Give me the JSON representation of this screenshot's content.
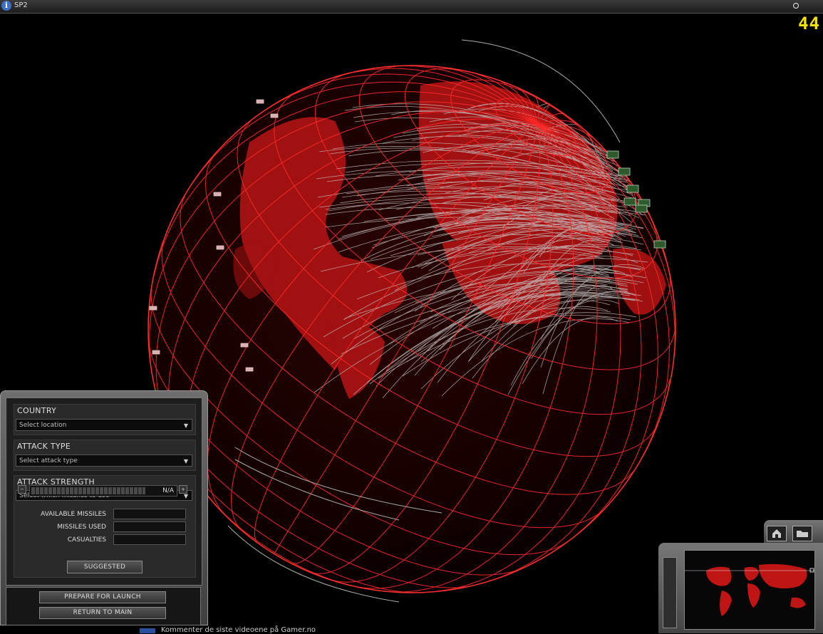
{
  "window": {
    "title": "SP2"
  },
  "hud": {
    "fps": "44"
  },
  "colors": {
    "globe_grid": "#ff2a2a",
    "land": "#b81414",
    "trails": "#c8c8c8",
    "fps": "#f2e200",
    "panel": "#4a4a4a"
  },
  "panel": {
    "country": {
      "label": "COUNTRY",
      "select": "Select location"
    },
    "attack_type": {
      "label": "ATTACK TYPE",
      "select": "Select attack type"
    },
    "attack_strength": {
      "label": "ATTACK STRENGTH",
      "select": "Select which missiles to use",
      "meter_value": "N/A"
    },
    "stats": [
      {
        "label": "AVAILABLE MISSILES",
        "value": ""
      },
      {
        "label": "MISSILES USED",
        "value": ""
      },
      {
        "label": "CASUALTIES",
        "value": ""
      }
    ],
    "suggested_button": "SUGGESTED",
    "prepare_button": "PREPARE FOR LAUNCH",
    "return_button": "RETURN TO MAIN"
  },
  "minimap": {
    "icons": [
      "home-icon",
      "folder-icon"
    ]
  },
  "bottom_overlay": {
    "text": "Kommenter de siste videoene på Gamer.no"
  }
}
